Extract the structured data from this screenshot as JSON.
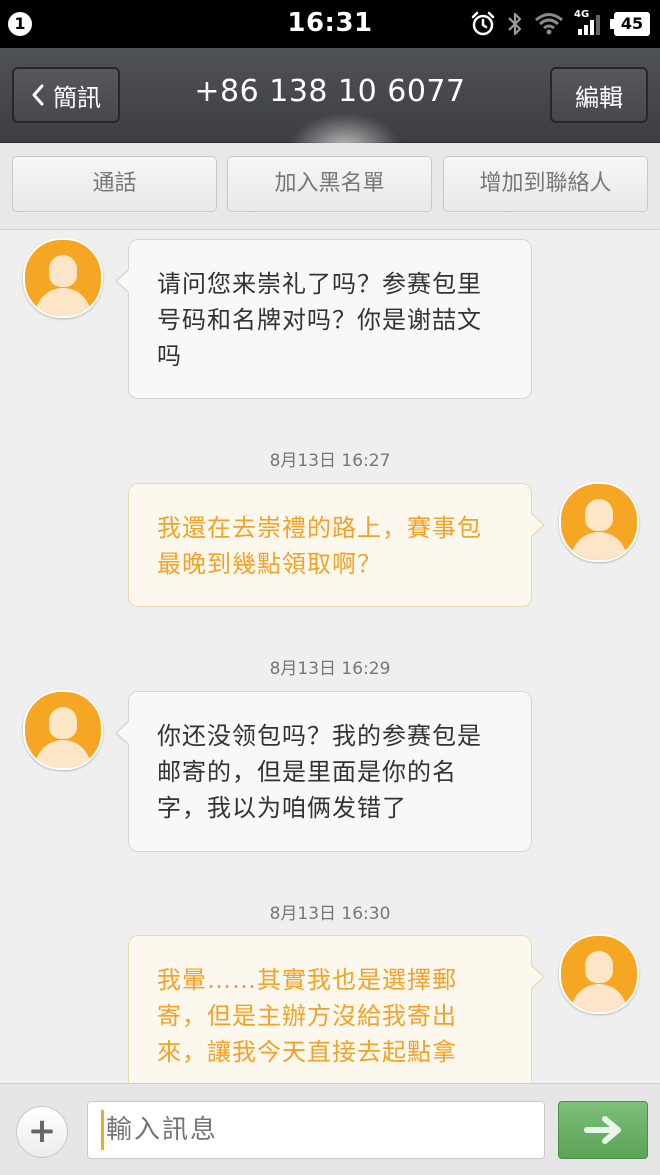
{
  "status_bar": {
    "notification_count": "1",
    "time": "16:31",
    "network_label": "4G",
    "battery": "45"
  },
  "header": {
    "back_label": "簡訊",
    "title": "+86 138    10 6077",
    "edit_label": "編輯"
  },
  "actions": {
    "call": "通話",
    "blacklist": "加入黑名單",
    "add_contact": "增加到聯絡人"
  },
  "messages": [
    {
      "direction": "incoming",
      "text": "请问您来崇礼了吗？参赛包里号码和名牌对吗？你是谢喆文吗"
    },
    {
      "timestamp": "8月13日 16:27"
    },
    {
      "direction": "outgoing",
      "text": "我還在去崇禮的路上，賽事包最晚到幾點領取啊？"
    },
    {
      "timestamp": "8月13日 16:29"
    },
    {
      "direction": "incoming",
      "text": "你还没领包吗？我的参赛包是邮寄的，但是里面是你的名字，我以为咱俩发错了"
    },
    {
      "timestamp": "8月13日 16:30"
    },
    {
      "direction": "outgoing",
      "text": "我暈……其實我也是選擇郵寄，但是主辦方沒給我寄出來，讓我今天直接去起點拿"
    }
  ],
  "message_lines": {
    "m1": [
      "请问您来崇礼了吗？参赛包里",
      "号码和名牌对吗？你是谢喆文",
      "吗"
    ],
    "m2": [
      "我還在去崇禮的路上，賽事包",
      "最晚到幾點領取啊？"
    ],
    "m3": [
      "你还没领包吗？我的参赛包是",
      "邮寄的，但是里面是你的名",
      "字，我以为咱俩发错了"
    ],
    "m4": [
      "我暈……其實我也是選擇郵",
      "寄，但是主辦方沒給我寄出",
      "來，讓我今天直接去起點拿"
    ]
  },
  "timestamps": {
    "t1": "8月13日 16:27",
    "t2": "8月13日 16:29",
    "t3": "8月13日 16:30"
  },
  "composer": {
    "add_label": "+",
    "placeholder": "輸入訊息"
  },
  "colors": {
    "accent": "#f5a623",
    "outgoing_text": "#f2a229",
    "send_button": "#62a95f",
    "header_bg": "#46484c"
  },
  "icons": {
    "back": "chevron-left-icon",
    "alarm": "alarm-icon",
    "bluetooth": "bluetooth-icon",
    "wifi": "wifi-icon",
    "signal": "signal-icon",
    "send": "send-arrow-icon",
    "avatar": "person-avatar-icon"
  }
}
